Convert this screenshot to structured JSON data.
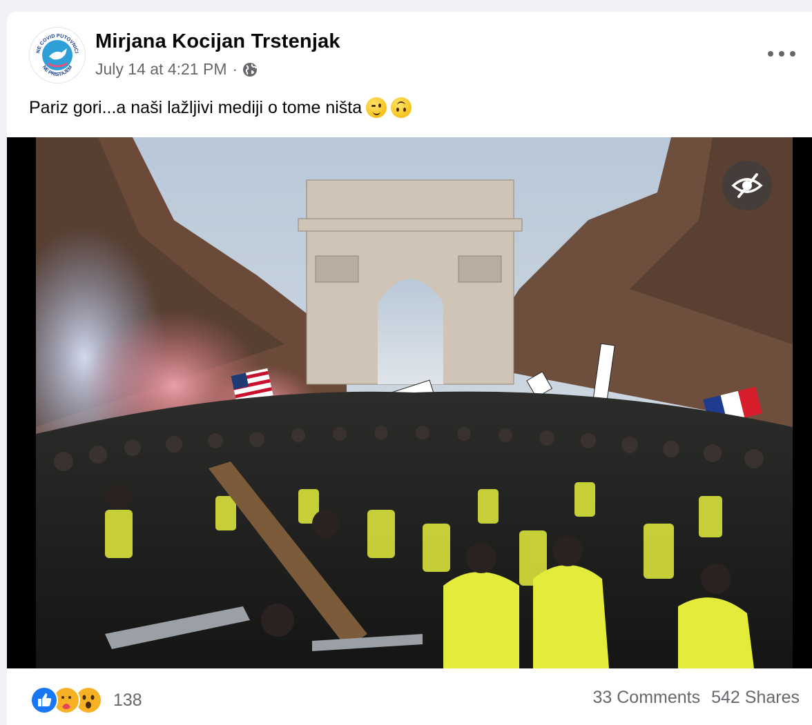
{
  "post": {
    "author": "Mirjana Kocijan Trstenjak",
    "timestamp": "July 14 at 4:21 PM",
    "separator": "·",
    "audience_icon": "globe-icon",
    "caption": "Pariz gori...a naši lažljivi mediji o tome ništa",
    "caption_emojis": [
      "wink-emoji",
      "upside-down-face-emoji"
    ]
  },
  "avatar": {
    "badge_top_text": "NE COVID PUTOVNICI",
    "badge_bottom_text": "NE PRISTAJEM"
  },
  "image": {
    "alt": "Crowd of protesters in yellow vests on the Champs-Élysées in front of the Arc de Triomphe",
    "hide_icon": "eye-slash-icon"
  },
  "footer": {
    "reaction_icons": [
      "like-icon",
      "care-icon",
      "wow-icon"
    ],
    "reaction_count": "138",
    "comments": "33 Comments",
    "shares": "542 Shares"
  },
  "colors": {
    "card": "#ffffff",
    "page_bg": "#f0f2f5",
    "secondary_text": "#65676b",
    "like_blue": "#1877f2"
  }
}
